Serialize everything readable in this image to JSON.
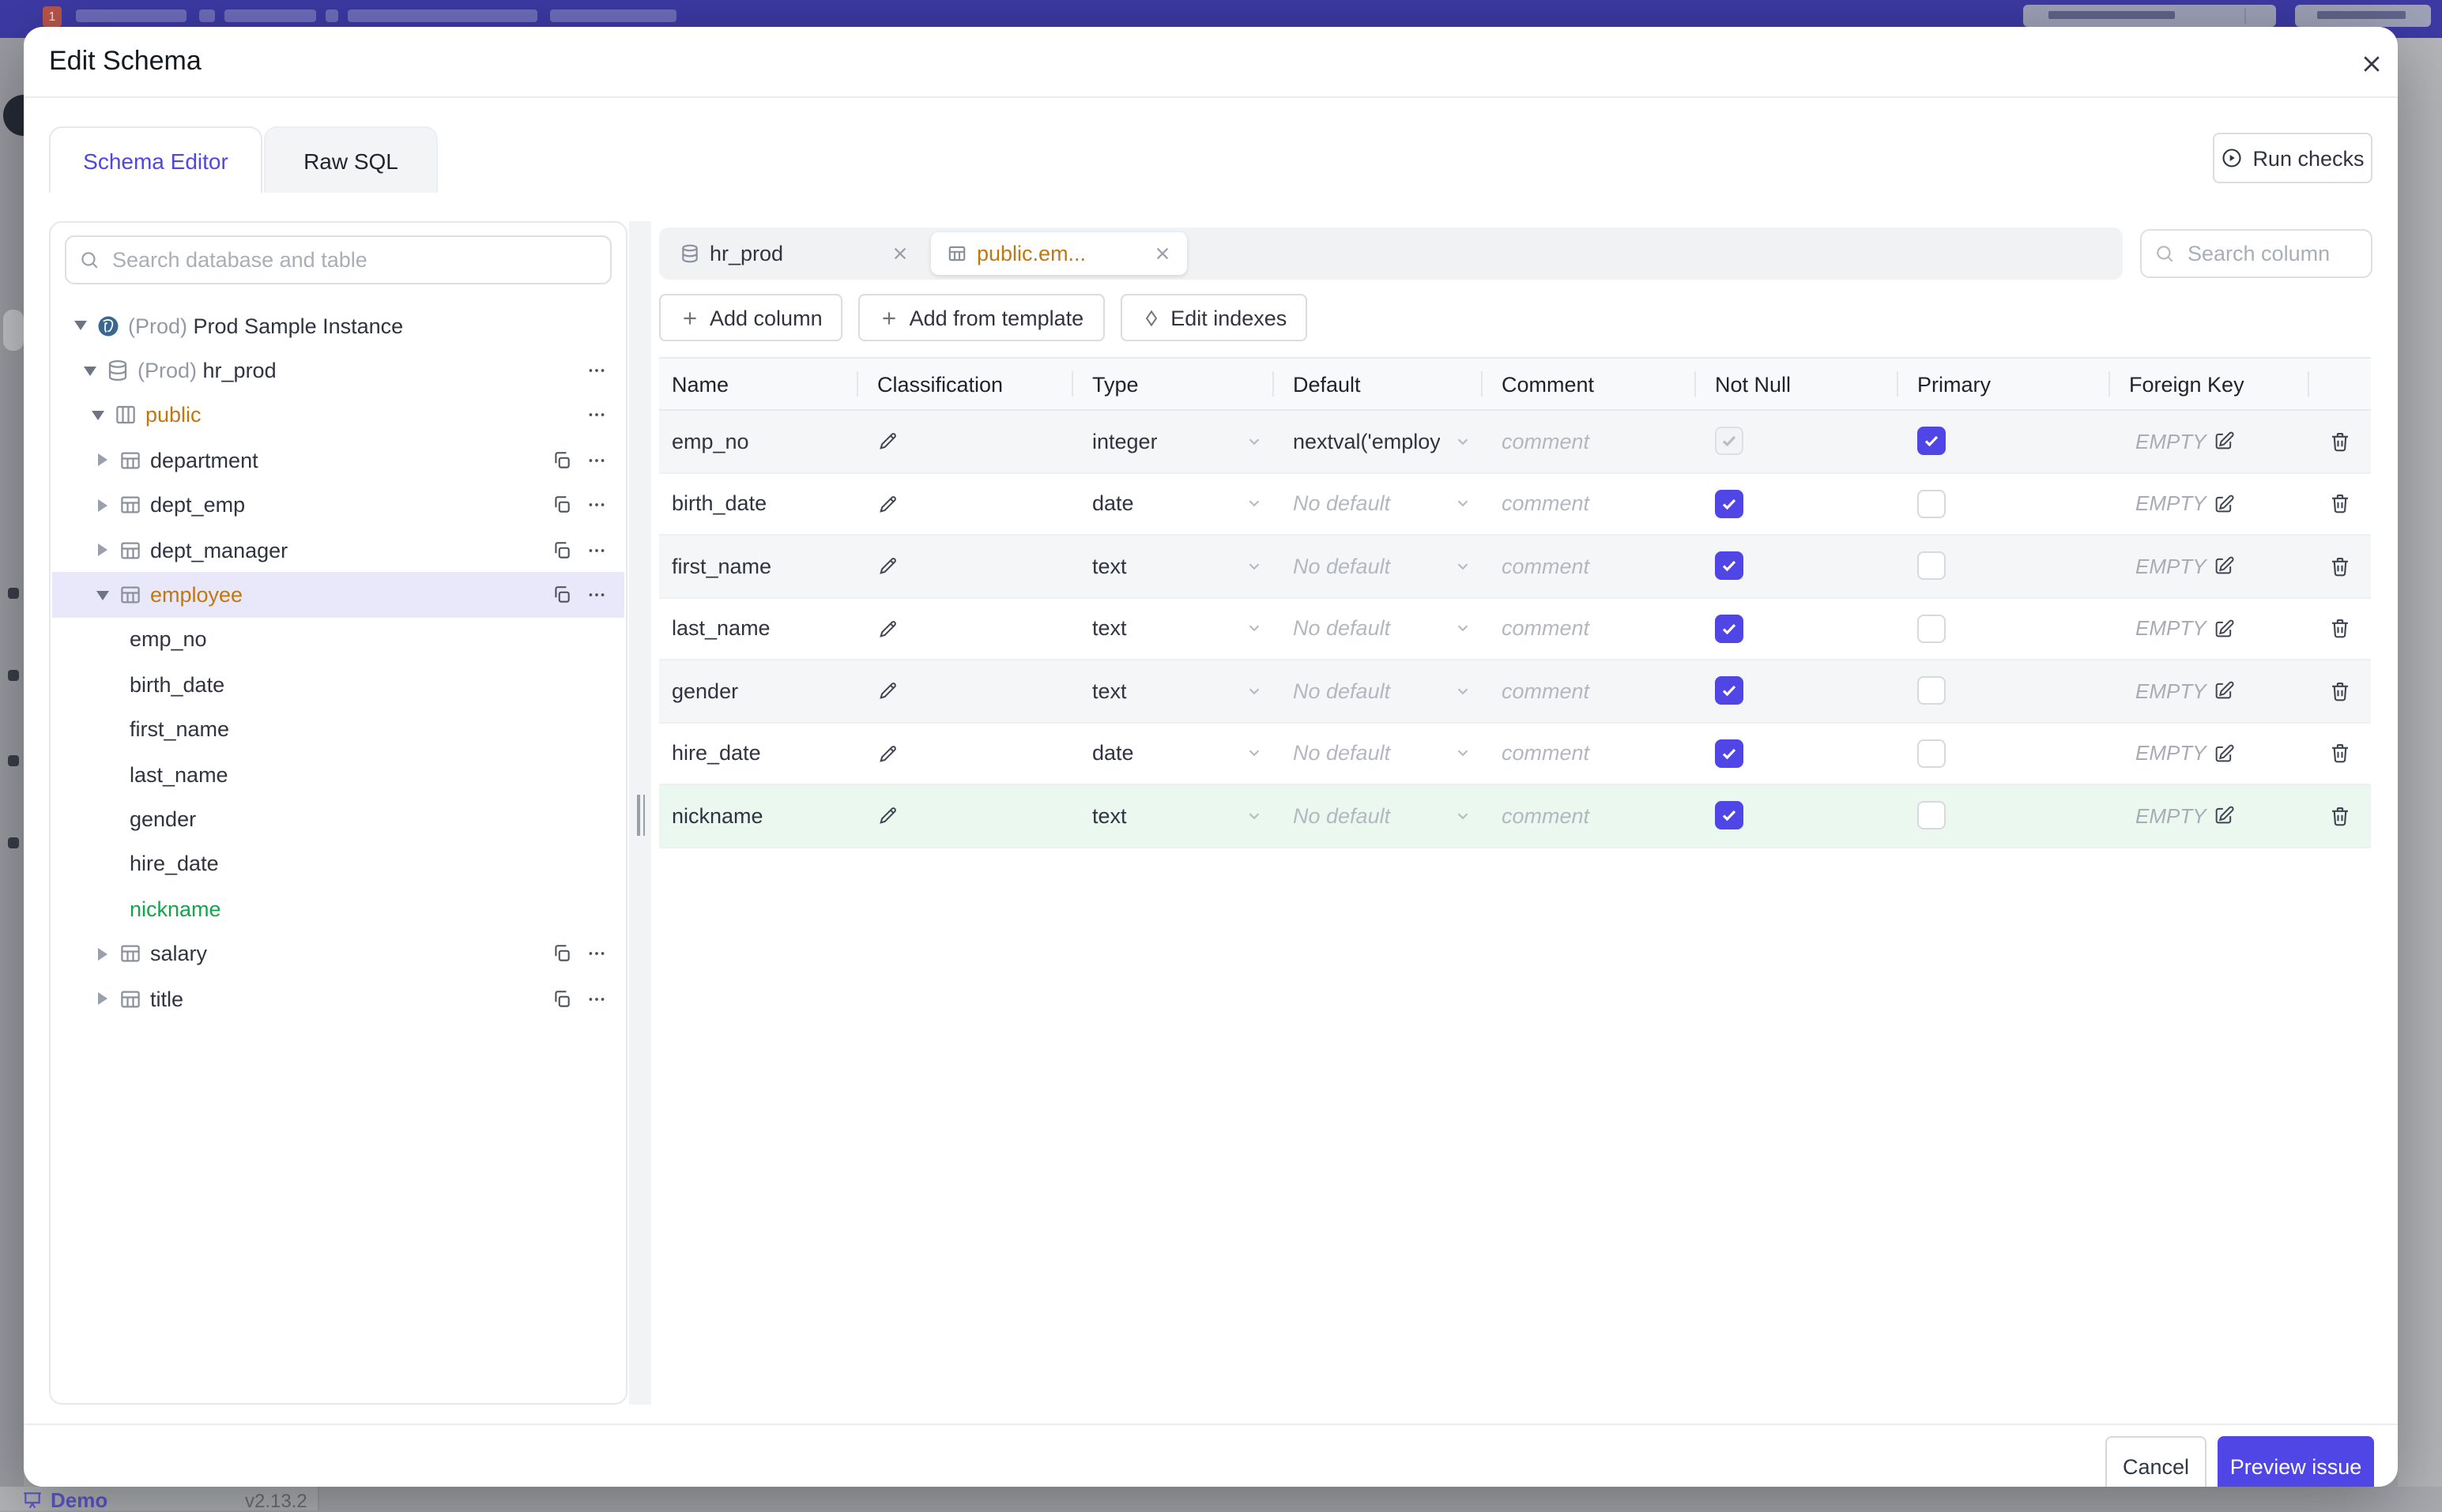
{
  "backdrop": {
    "brand": "Demo",
    "version": "v2.13.2",
    "badge": "1"
  },
  "modal": {
    "title": "Edit Schema",
    "tabs": {
      "schema_editor": "Schema Editor",
      "raw_sql": "Raw SQL"
    },
    "run_checks": "Run checks",
    "footer": {
      "cancel": "Cancel",
      "submit": "Preview issue"
    }
  },
  "sidebar": {
    "search_placeholder": "Search database and table",
    "tree": [
      {
        "label": "Prod Sample Instance",
        "prefix": "(Prod) ",
        "level": 0,
        "caret_down": true,
        "icon_pg": true
      },
      {
        "label": "hr_prod",
        "prefix": "(Prod) ",
        "level": 1,
        "caret_down": true,
        "icon_db": true,
        "dots": true
      },
      {
        "label": "public",
        "level": 2,
        "caret_down": true,
        "icon_schema": true,
        "modified": true,
        "dots": true
      },
      {
        "label": "department",
        "level": 3,
        "caret_right": true,
        "icon_table": true,
        "copy": true,
        "dots": true
      },
      {
        "label": "dept_emp",
        "level": 3,
        "caret_right": true,
        "icon_table": true,
        "copy": true,
        "dots": true
      },
      {
        "label": "dept_manager",
        "level": 3,
        "caret_right": true,
        "icon_table": true,
        "copy": true,
        "dots": true
      },
      {
        "label": "employee",
        "level": 3,
        "caret_down": true,
        "icon_table": true,
        "modified": true,
        "selected": true,
        "copy": true,
        "dots": true
      },
      {
        "label": "emp_no",
        "level": 4
      },
      {
        "label": "birth_date",
        "level": 4
      },
      {
        "label": "first_name",
        "level": 4
      },
      {
        "label": "last_name",
        "level": 4
      },
      {
        "label": "gender",
        "level": 4
      },
      {
        "label": "hire_date",
        "level": 4
      },
      {
        "label": "nickname",
        "level": 4,
        "new_col": true
      },
      {
        "label": "salary",
        "level": 3,
        "caret_right": true,
        "icon_table": true,
        "copy": true,
        "dots": true
      },
      {
        "label": "title",
        "level": 3,
        "caret_right": true,
        "icon_table": true,
        "copy": true,
        "dots": true
      }
    ]
  },
  "editor": {
    "tabs": [
      {
        "label": "hr_prod"
      },
      {
        "label": "public.em..."
      }
    ],
    "toolbar": {
      "add_column": "Add column",
      "add_from_template": "Add from template",
      "edit_indexes": "Edit indexes"
    },
    "search_placeholder": "Search column",
    "table": {
      "headers": [
        "Name",
        "Classification",
        "Type",
        "Default",
        "Comment",
        "Not Null",
        "Primary",
        "Foreign Key"
      ],
      "comment_placeholder": "comment",
      "foreign_key_value": "EMPTY",
      "rows": [
        {
          "name": "emp_no",
          "type": "integer",
          "default": "nextval('employ",
          "has_default": true,
          "nn_dis": true,
          "pk_on": true
        },
        {
          "name": "birth_date",
          "type": "date",
          "default": "No default",
          "nn_on": true
        },
        {
          "name": "first_name",
          "type": "text",
          "default": "No default",
          "nn_on": true
        },
        {
          "name": "last_name",
          "type": "text",
          "default": "No default",
          "nn_on": true
        },
        {
          "name": "gender",
          "type": "text",
          "default": "No default",
          "nn_on": true
        },
        {
          "name": "hire_date",
          "type": "date",
          "default": "No default",
          "nn_on": true
        },
        {
          "name": "nickname",
          "type": "text",
          "default": "No default",
          "nn_on": true,
          "is_new": true
        }
      ]
    }
  },
  "colors": {
    "accent": "#4f46e5",
    "modified": "#c2770d",
    "new_item": "#16a34a",
    "topbar": "#3d3aa5"
  }
}
